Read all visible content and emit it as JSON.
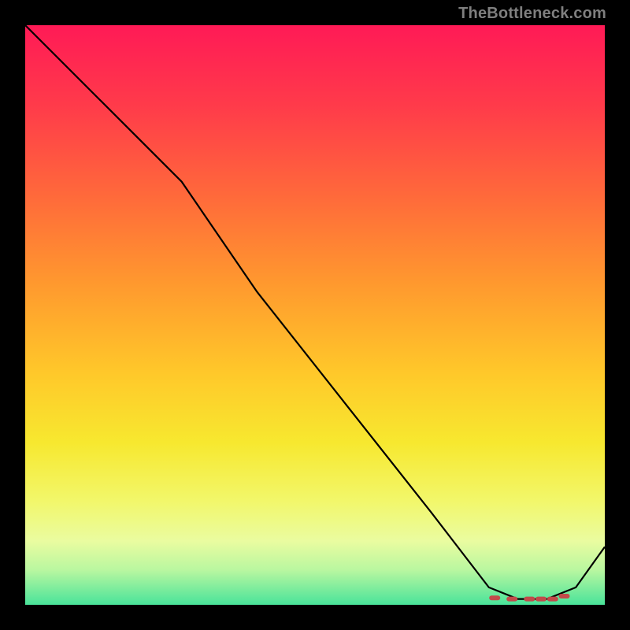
{
  "watermark": "TheBottleneck.com",
  "chart_data": {
    "type": "line",
    "title": "",
    "xlabel": "",
    "ylabel": "",
    "xlim": [
      0,
      100
    ],
    "ylim": [
      0,
      100
    ],
    "grid": false,
    "series": [
      {
        "name": "bottleneck-curve",
        "x": [
          0,
          10,
          20,
          27,
          40,
          55,
          70,
          80,
          85,
          90,
          95,
          100
        ],
        "values": [
          100,
          90,
          80,
          73,
          54,
          35,
          16,
          3,
          1,
          1,
          3,
          10
        ]
      }
    ],
    "markers": {
      "name": "optimal-zone",
      "x": [
        81,
        84,
        87,
        89,
        91,
        93
      ],
      "values": [
        1.2,
        1.0,
        1.0,
        1.0,
        1.0,
        1.5
      ],
      "color": "#c24a4a"
    },
    "background_gradient": {
      "top": "#ff1a56",
      "middle": "#ffe032",
      "bottom": "#49e39a"
    }
  }
}
